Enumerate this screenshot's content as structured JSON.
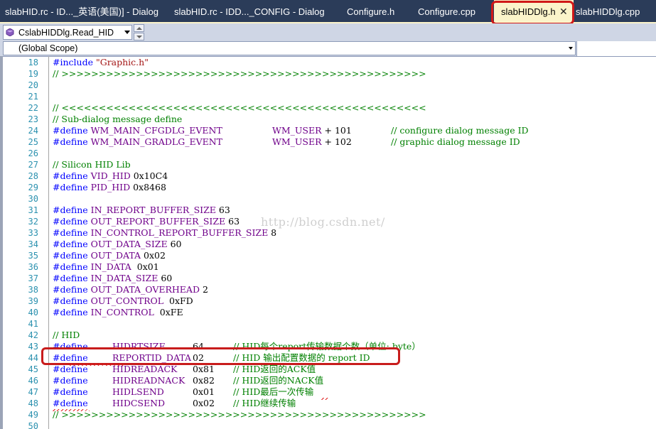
{
  "tabs": [
    {
      "label": "slabHID.rc - ID..._英语(美国)] - Dialog",
      "active": false
    },
    {
      "label": "slabHID.rc - IDD..._CONFIG - Dialog",
      "active": false
    },
    {
      "label": "Configure.h",
      "active": false
    },
    {
      "label": "Configure.cpp",
      "active": false
    },
    {
      "label": "slabHIDDlg.h",
      "active": true
    },
    {
      "label": "slabHIDDlg.cpp",
      "active": false
    }
  ],
  "tab_close_glyph": "✕",
  "nav": {
    "member_combo": "CslabHIDDlg.Read_HID",
    "scope_combo": "(Global Scope)"
  },
  "watermark": "http://blog.csdn.net/",
  "colors": {
    "keyword": "#0000ff",
    "macro": "#6f008a",
    "comment": "#008000",
    "string": "#a31515",
    "line_number": "#2b91af",
    "tabstrip": "#2b3c59",
    "active_tab": "#fbf4ca",
    "highlight_box": "#d01818"
  },
  "code_lines": [
    {
      "n": "18",
      "segs": [
        {
          "t": "#include ",
          "c": "kw"
        },
        {
          "t": "\"Graphic.h\"",
          "c": "str"
        }
      ]
    },
    {
      "n": "19",
      "segs": [
        {
          "t": "// >>>>>>>>>>>>>>>>>>>>>>>>>>>>>>>>>>>>>>>>>>>>>>>>>",
          "c": "cm"
        }
      ]
    },
    {
      "n": "20",
      "segs": []
    },
    {
      "n": "21",
      "segs": []
    },
    {
      "n": "22",
      "segs": [
        {
          "t": "// <<<<<<<<<<<<<<<<<<<<<<<<<<<<<<<<<<<<<<<<<<<<<<<<<",
          "c": "cm"
        }
      ]
    },
    {
      "n": "23",
      "segs": [
        {
          "t": "// Sub-dialog message define",
          "c": "cm"
        }
      ]
    },
    {
      "n": "24",
      "segs": [
        {
          "t": "#define ",
          "c": "kw"
        },
        {
          "t": "WM_MAIN_CFGDLG_EVENT",
          "c": "mac"
        },
        {
          "t": "WM_USER",
          "c": "mac",
          "at": 309
        },
        {
          "t": " + 101",
          "c": ""
        },
        {
          "t": "// configure dialog message ID",
          "c": "cm",
          "at": 476
        }
      ]
    },
    {
      "n": "25",
      "segs": [
        {
          "t": "#define ",
          "c": "kw"
        },
        {
          "t": "WM_MAIN_GRADLG_EVENT",
          "c": "mac"
        },
        {
          "t": "WM_USER",
          "c": "mac",
          "at": 309
        },
        {
          "t": " + 102",
          "c": ""
        },
        {
          "t": "// graphic dialog message ID",
          "c": "cm",
          "at": 476
        }
      ]
    },
    {
      "n": "26",
      "segs": []
    },
    {
      "n": "27",
      "segs": [
        {
          "t": "// Silicon HID Lib",
          "c": "cm"
        }
      ]
    },
    {
      "n": "28",
      "segs": [
        {
          "t": "#define ",
          "c": "kw"
        },
        {
          "t": "VID_HID",
          "c": "mac"
        },
        {
          "t": " 0x10C4",
          "c": ""
        }
      ]
    },
    {
      "n": "29",
      "segs": [
        {
          "t": "#define ",
          "c": "kw"
        },
        {
          "t": "PID_HID",
          "c": "mac"
        },
        {
          "t": " 0x8468",
          "c": ""
        }
      ]
    },
    {
      "n": "30",
      "segs": []
    },
    {
      "n": "31",
      "segs": [
        {
          "t": "#define ",
          "c": "kw"
        },
        {
          "t": "IN_REPORT_BUFFER_SIZE",
          "c": "mac"
        },
        {
          "t": " 63",
          "c": ""
        }
      ]
    },
    {
      "n": "32",
      "segs": [
        {
          "t": "#define ",
          "c": "kw"
        },
        {
          "t": "OUT_REPORT_BUFFER_SIZE",
          "c": "mac"
        },
        {
          "t": " 63",
          "c": ""
        }
      ]
    },
    {
      "n": "33",
      "segs": [
        {
          "t": "#define ",
          "c": "kw"
        },
        {
          "t": "IN_CONTROL_REPORT_BUFFER_SIZE",
          "c": "mac"
        },
        {
          "t": " 8",
          "c": ""
        }
      ]
    },
    {
      "n": "34",
      "segs": [
        {
          "t": "#define ",
          "c": "kw"
        },
        {
          "t": "OUT_DATA_SIZE",
          "c": "mac"
        },
        {
          "t": " 60",
          "c": ""
        }
      ]
    },
    {
      "n": "35",
      "segs": [
        {
          "t": "#define ",
          "c": "kw"
        },
        {
          "t": "OUT_DATA",
          "c": "mac"
        },
        {
          "t": " 0x02",
          "c": ""
        }
      ]
    },
    {
      "n": "36",
      "segs": [
        {
          "t": "#define ",
          "c": "kw"
        },
        {
          "t": "IN_DATA",
          "c": "mac"
        },
        {
          "t": "  0x01",
          "c": ""
        }
      ]
    },
    {
      "n": "37",
      "segs": [
        {
          "t": "#define ",
          "c": "kw"
        },
        {
          "t": "IN_DATA_SIZE",
          "c": "mac"
        },
        {
          "t": " 60",
          "c": ""
        }
      ]
    },
    {
      "n": "38",
      "segs": [
        {
          "t": "#define ",
          "c": "kw"
        },
        {
          "t": "OUT_DATA_OVERHEAD",
          "c": "mac"
        },
        {
          "t": " 2",
          "c": ""
        }
      ]
    },
    {
      "n": "39",
      "segs": [
        {
          "t": "#define ",
          "c": "kw"
        },
        {
          "t": "OUT_CONTROL",
          "c": "mac"
        },
        {
          "t": "  0xFD",
          "c": ""
        }
      ]
    },
    {
      "n": "40",
      "segs": [
        {
          "t": "#define ",
          "c": "kw"
        },
        {
          "t": "IN_CONTROL",
          "c": "mac"
        },
        {
          "t": "  0xFE",
          "c": ""
        }
      ]
    },
    {
      "n": "41",
      "segs": []
    },
    {
      "n": "42",
      "segs": [
        {
          "t": "// HID",
          "c": "cm"
        }
      ]
    },
    {
      "n": "43",
      "segs": [
        {
          "t": "#define",
          "c": "kw"
        },
        {
          "t": "HIDRTSIZE",
          "c": "mac",
          "at": 84
        },
        {
          "t": "64",
          "c": "",
          "at": 197
        },
        {
          "t": "// HID每个report传输数据个数（单位: byte）",
          "c": "cm",
          "at": 254
        }
      ]
    },
    {
      "n": "44",
      "segs": [
        {
          "t": "#define",
          "c": "kw"
        },
        {
          "t": "REPORTID_DATA",
          "c": "mac",
          "at": 84
        },
        {
          "t": "02",
          "c": "",
          "at": 197
        },
        {
          "t": "// HID 输出配置数据的 report ID",
          "c": "cm",
          "at": 254
        }
      ]
    },
    {
      "n": "45",
      "segs": [
        {
          "t": "#define",
          "c": "kw"
        },
        {
          "t": "HIDREADACK",
          "c": "mac",
          "at": 84
        },
        {
          "t": "0x81",
          "c": "",
          "at": 197
        },
        {
          "t": "// HID返回的ACK值",
          "c": "cm",
          "at": 254
        }
      ]
    },
    {
      "n": "46",
      "segs": [
        {
          "t": "#define",
          "c": "kw"
        },
        {
          "t": "HIDREADNACK",
          "c": "mac",
          "at": 84
        },
        {
          "t": "0x82",
          "c": "",
          "at": 197
        },
        {
          "t": "// HID返回的NACK值",
          "c": "cm",
          "at": 254
        }
      ]
    },
    {
      "n": "47",
      "segs": [
        {
          "t": "#define",
          "c": "kw"
        },
        {
          "t": "HIDLSEND",
          "c": "mac",
          "at": 84
        },
        {
          "t": "0x01",
          "c": "",
          "at": 197
        },
        {
          "t": "// HID最后一次传输",
          "c": "cm",
          "at": 254
        }
      ]
    },
    {
      "n": "48",
      "segs": [
        {
          "t": "#define",
          "c": "kw"
        },
        {
          "t": "HIDCSEND",
          "c": "mac",
          "at": 84
        },
        {
          "t": "0x02",
          "c": "",
          "at": 197
        },
        {
          "t": "// HID继续传输",
          "c": "cm",
          "at": 254
        }
      ]
    },
    {
      "n": "49",
      "segs": [
        {
          "t": "// >>>>>>>>>>>>>>>>>>>>>>>>>>>>>>>>>>>>>>>>>>>>>>>>>",
          "c": "cm"
        }
      ]
    },
    {
      "n": "50",
      "segs": []
    }
  ]
}
